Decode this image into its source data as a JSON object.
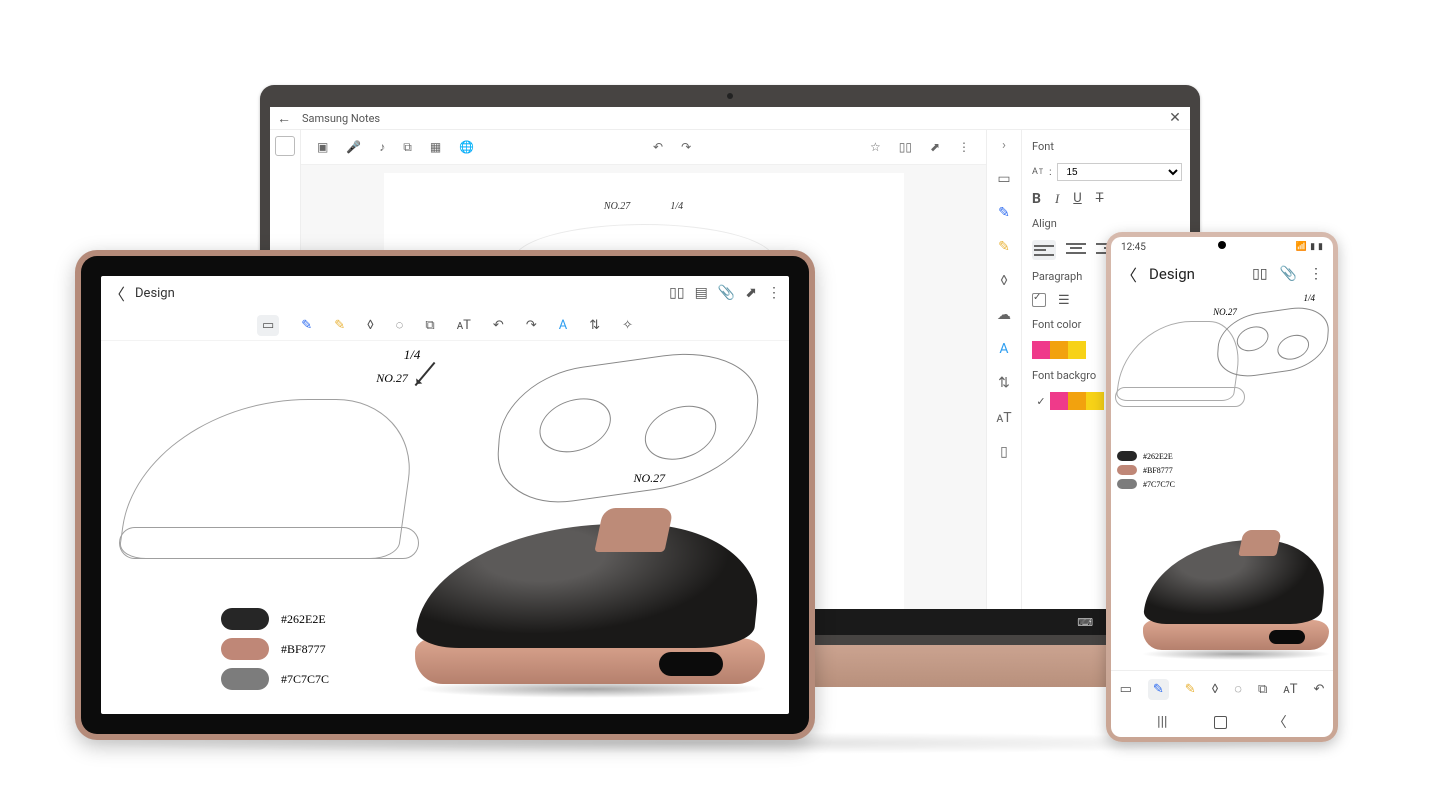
{
  "laptop": {
    "app_title": "Samsung Notes",
    "font_panel": {
      "header": "Font",
      "size_value": "15",
      "align_header": "Align",
      "paragraph_header": "Paragraph",
      "font_color_header": "Font color",
      "font_bg_header": "Font backgro",
      "color_swatches": [
        "#ef3a8a",
        "#f2a20e",
        "#f7d217"
      ],
      "bg_swatches": [
        "#ef3a8a",
        "#f2a20e",
        "#f7d217"
      ]
    },
    "canvas": {
      "fraction": "1/4",
      "label_no": "NO.27"
    }
  },
  "tablet": {
    "title": "Design",
    "canvas": {
      "fraction": "1/4",
      "label_no_a": "NO.27",
      "label_no_b": "NO.27",
      "swatches": [
        {
          "hex": "#262626",
          "label": "#262E2E"
        },
        {
          "hex": "#bf8777",
          "label": "#BF8777"
        },
        {
          "hex": "#7c7c7c",
          "label": "#7C7C7C"
        }
      ]
    }
  },
  "phone": {
    "status_time": "12:45",
    "title": "Design",
    "canvas": {
      "fraction": "1/4",
      "label_no": "NO.27",
      "swatches": [
        {
          "hex": "#262626",
          "label": "#262E2E"
        },
        {
          "hex": "#bf8777",
          "label": "#BF8777"
        },
        {
          "hex": "#7c7c7c",
          "label": "#7C7C7C"
        }
      ]
    }
  }
}
